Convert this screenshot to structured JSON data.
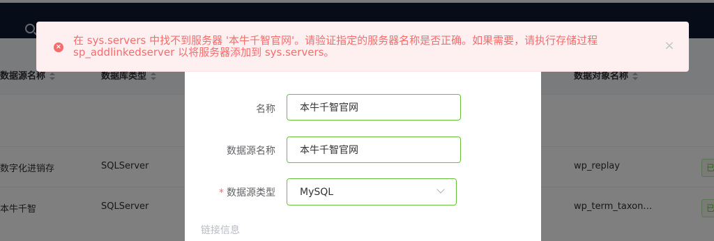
{
  "header": {
    "search_icon": "search-icon"
  },
  "table": {
    "columns": [
      "数据源名称",
      "数据库类型",
      "数据对象名称"
    ],
    "rows": [
      {
        "source_name": "数字化进销存",
        "db_type": "SQLServer",
        "object_name": "wp_replay",
        "tag": "已"
      },
      {
        "source_name": "本牛千智",
        "db_type": "SQLServer",
        "object_name": "wp_term_taxon…",
        "tag": "已"
      }
    ]
  },
  "dialog": {
    "fields": [
      {
        "label": "名称",
        "value": "本牛千智官网",
        "required": false
      },
      {
        "label": "数据源名称",
        "value": "本牛千智官网",
        "required": false
      },
      {
        "label": "数据源类型",
        "value": "MySQL",
        "required": true
      }
    ],
    "required_mark": "*",
    "section_title": "链接信息"
  },
  "message": {
    "type": "error",
    "text": "在 sys.servers 中找不到服务器 '本牛千智官网'。请验证指定的服务器名称是否正确。如果需要，请执行存储过程 sp_addlinkedserver 以将服务器添加到 sys.servers。",
    "close_symbol": "×",
    "error_symbol": "×"
  },
  "colors": {
    "header_bg": "#0c1a33",
    "error": "#f56c6c",
    "success_border": "#67c23a"
  }
}
